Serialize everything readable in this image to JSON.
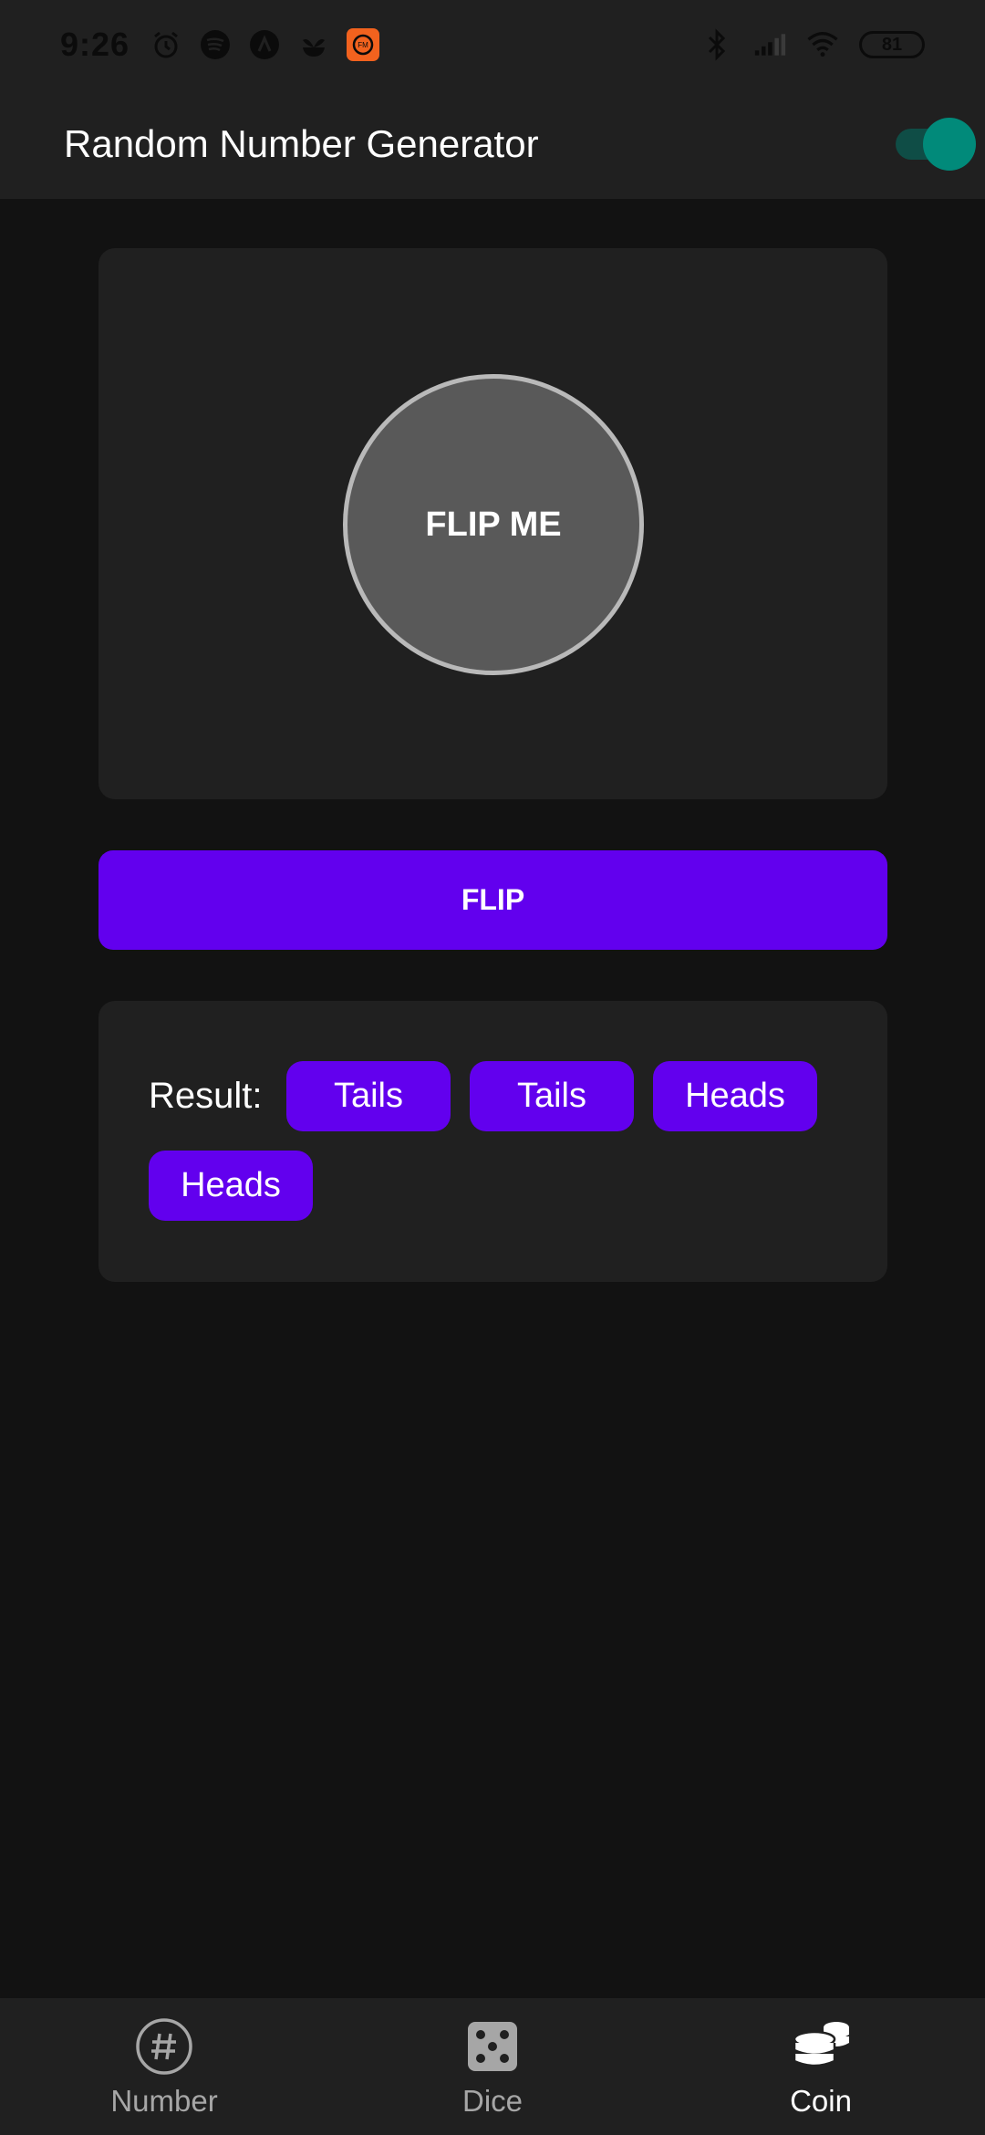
{
  "status_bar": {
    "time": "9:26",
    "battery": "81",
    "icons": [
      "alarm-icon",
      "spotify-icon",
      "app-icon",
      "plant-icon",
      "fm-app-icon",
      "bluetooth-icon",
      "signal-icon",
      "wifi-icon",
      "battery-icon"
    ]
  },
  "app_bar": {
    "title": "Random Number Generator",
    "toggle_on": true
  },
  "coin": {
    "label": "FLIP ME"
  },
  "flip_button": {
    "label": "FLIP"
  },
  "result": {
    "label": "Result:",
    "items": [
      "Tails",
      "Tails",
      "Heads",
      "Heads"
    ]
  },
  "bottom_nav": {
    "items": [
      {
        "label": "Number",
        "icon": "hash-icon",
        "active": false
      },
      {
        "label": "Dice",
        "icon": "dice-icon",
        "active": false
      },
      {
        "label": "Coin",
        "icon": "coins-icon",
        "active": true
      }
    ]
  },
  "colors": {
    "background": "#121212",
    "surface": "#202020",
    "primary": "#6200ee",
    "toggle_thumb": "#018a7a",
    "coin_fill": "#595959"
  }
}
